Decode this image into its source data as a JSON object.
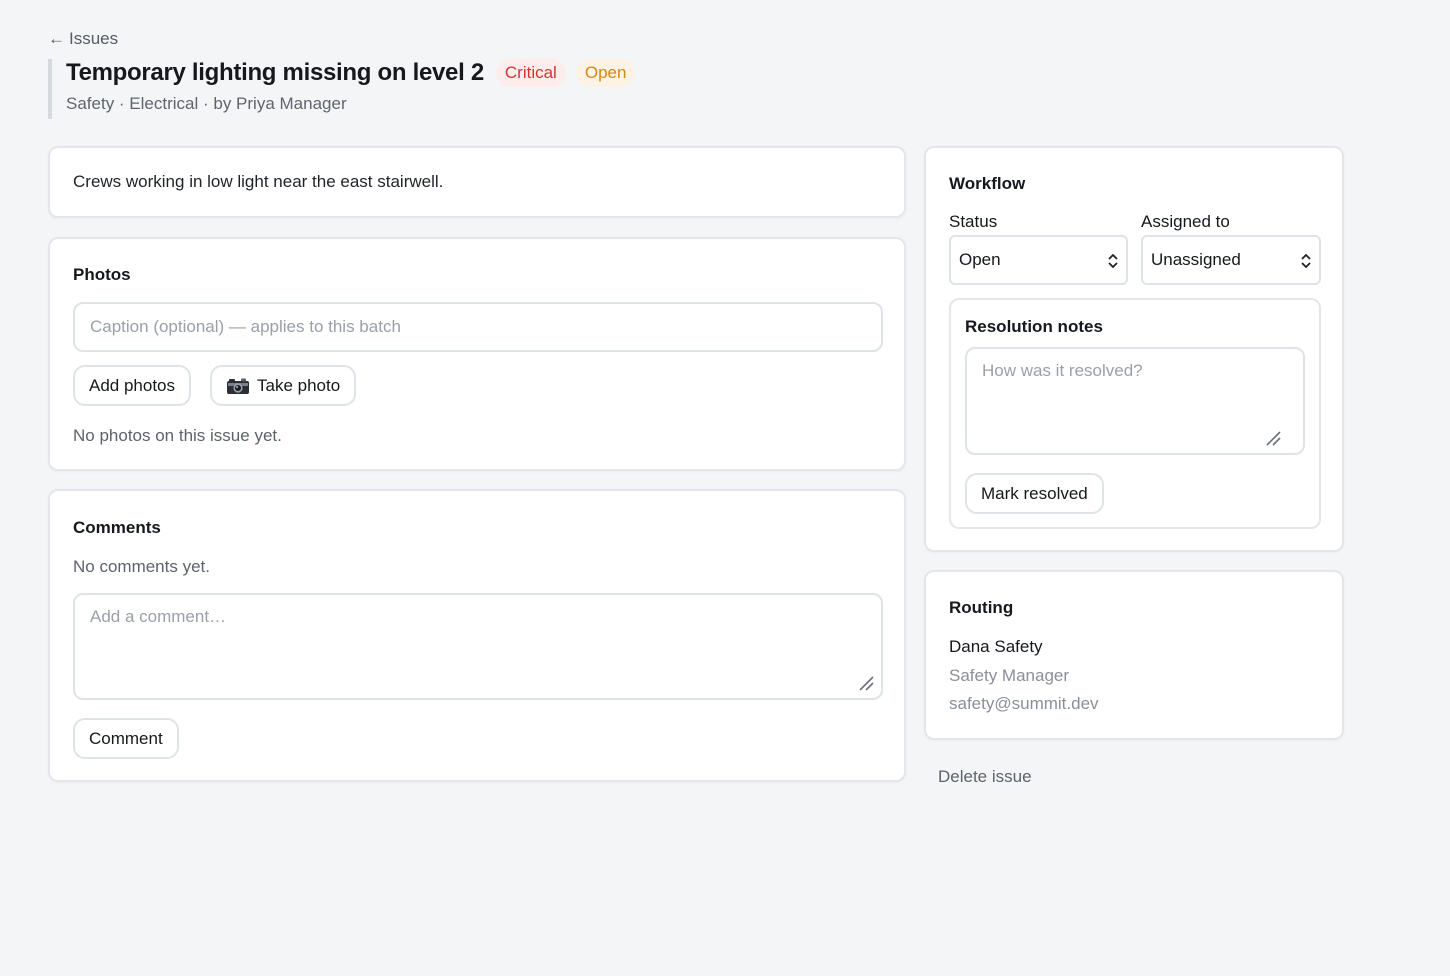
{
  "nav": {
    "back_arrow": "←",
    "back_label": "Issues"
  },
  "issue": {
    "title": "Temporary lighting missing on level 2",
    "severity": "Critical",
    "status_badge": "Open",
    "meta": "Safety · Electrical · by Priya Manager",
    "description": "Crews working in low light near the east stairwell."
  },
  "photos": {
    "title": "Photos",
    "caption_placeholder": "Caption (optional) — applies to this batch",
    "add_photos_label": "Add photos",
    "take_photo_label": "Take photo",
    "take_photo_icon": "camera-icon",
    "empty_text": "No photos on this issue yet."
  },
  "comments": {
    "title": "Comments",
    "empty_text": "No comments yet.",
    "input_placeholder": "Add a comment…",
    "submit_label": "Comment"
  },
  "workflow": {
    "title": "Workflow",
    "status_label": "Status",
    "status_value": "Open",
    "assigned_label": "Assigned to",
    "assigned_value": "Unassigned",
    "resolution": {
      "title": "Resolution notes",
      "placeholder": "How was it resolved?",
      "submit_label": "Mark resolved"
    }
  },
  "routing": {
    "title": "Routing",
    "name": "Dana Safety",
    "role": "Safety Manager",
    "email": "safety@summit.dev"
  },
  "actions": {
    "delete_label": "Delete issue"
  },
  "colors": {
    "background": "#f4f5f7",
    "critical_text": "#d0392f",
    "critical_bg": "#fdecec",
    "open_text": "#d48718",
    "open_bg": "#fdf3e4"
  }
}
